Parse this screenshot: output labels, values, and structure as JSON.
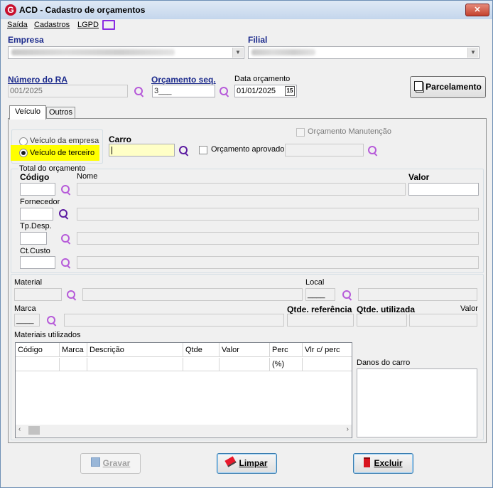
{
  "window": {
    "title": "ACD - Cadastro de orçamentos",
    "close_label": "✕"
  },
  "menu": {
    "items": [
      "Saída",
      "Cadastros",
      "LGPD"
    ]
  },
  "empresa": {
    "label": "Empresa"
  },
  "filial": {
    "label": "Filial"
  },
  "ra": {
    "label": "Número do RA",
    "value": "001/2025"
  },
  "orc_seq": {
    "label": "Orçamento seq.",
    "value": "3___"
  },
  "data_orc": {
    "label": "Data orçamento",
    "value": "01/01/2025",
    "cal_label": "15"
  },
  "parcelamento": {
    "label": "Parcelamento"
  },
  "tabs": [
    {
      "label": "Veículo"
    },
    {
      "label": "Outros"
    }
  ],
  "vehicle": {
    "radio_empresa": "Veículo da empresa",
    "radio_terceiro": "Veículo de terceiro",
    "carro_label": "Carro",
    "orc_manutencao": "Orçamento Manutenção",
    "orc_aprovado": "Orçamento aprovado"
  },
  "total": {
    "group_title": "Total do orçamento",
    "codigo": "Código",
    "nome": "Nome",
    "valor": "Valor",
    "fornecedor": "Fornecedor",
    "tp_desp": "Tp.Desp.",
    "ct_custo": "Ct.Custo"
  },
  "material": {
    "label": "Material",
    "local": "Local",
    "local_value": "____",
    "marca": "Marca",
    "marca_value": "____",
    "qtde_ref": "Qtde. referência",
    "qtde_util": "Qtde. utilizada",
    "valor": "Valor",
    "materiais_utilizados": "Materiais utilizados",
    "danos": "Danos do carro"
  },
  "grid": {
    "columns": [
      "Código",
      "Marca",
      "Descrição",
      "Qtde",
      "Valor",
      "Perc (%)",
      "Vlr c/ perc"
    ]
  },
  "buttons": {
    "gravar": "Gravar",
    "limpar": "Limpar",
    "excluir": "Excluir"
  },
  "icons": {
    "search": "search-icon",
    "calendar": "calendar-icon",
    "monitor": "monitor-icon"
  }
}
